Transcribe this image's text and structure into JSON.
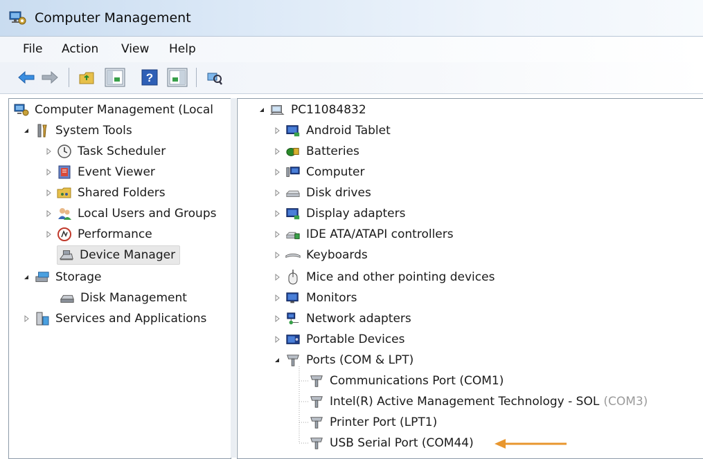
{
  "window": {
    "title": "Computer Management"
  },
  "menu": {
    "file": "File",
    "action": "Action",
    "view": "View",
    "help": "Help"
  },
  "toolbar": {
    "icons": [
      "back-arrow-icon",
      "forward-arrow-icon",
      "up-folder-icon",
      "show-hide-console-tree-icon",
      "help-icon",
      "show-hide-action-pane-icon",
      "scan-hardware-icon"
    ]
  },
  "left_tree": {
    "root": "Computer Management (Local",
    "system_tools": "System Tools",
    "task_scheduler": "Task Scheduler",
    "event_viewer": "Event Viewer",
    "shared_folders": "Shared Folders",
    "local_users": "Local Users and Groups",
    "performance": "Performance",
    "device_manager": "Device Manager",
    "storage": "Storage",
    "disk_management": "Disk Management",
    "services": "Services and Applications"
  },
  "device_tree": {
    "root": "PC11084832",
    "categories": [
      "Android Tablet",
      "Batteries",
      "Computer",
      "Disk drives",
      "Display adapters",
      "IDE ATA/ATAPI controllers",
      "Keyboards",
      "Mice and other pointing devices",
      "Monitors",
      "Network adapters",
      "Portable Devices",
      "Ports (COM & LPT)"
    ],
    "ports": {
      "com1": "Communications Port (COM1)",
      "amt_main": "Intel(R) Active Management Technology - SOL",
      "amt_suffix": "(COM3)",
      "lpt1": "Printer Port (LPT1)",
      "usb": "USB Serial Port (COM44)"
    }
  },
  "colors": {
    "arrow": "#e8962e",
    "selection": "#e8e8e8"
  }
}
